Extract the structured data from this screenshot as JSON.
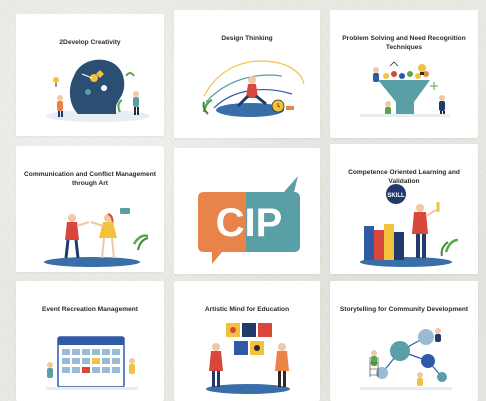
{
  "cards": [
    {
      "title": "2Develop Creativity",
      "icon": "creativity-illustration"
    },
    {
      "title": "Design Thinking",
      "icon": "design-thinking-illustration"
    },
    {
      "title": "Problem Solving and Need Recognition Techniques",
      "icon": "problem-solving-illustration"
    },
    {
      "title": "Communication and Conflict Management through Art",
      "icon": "communication-illustration"
    },
    {
      "title": "",
      "icon": "cip-logo"
    },
    {
      "title": "Competence Oriented Learning and Validation",
      "icon": "competence-illustration"
    },
    {
      "title": "Event Recreation Management",
      "icon": "event-calendar-illustration"
    },
    {
      "title": "Artistic Mind for Education",
      "icon": "artistic-mind-illustration"
    },
    {
      "title": "Storytelling for Community Development",
      "icon": "storytelling-illustration"
    }
  ],
  "logo": {
    "text": "CIP"
  },
  "competence_badge": {
    "text": "SKILL"
  },
  "colors": {
    "orange": "#e8844a",
    "teal": "#5a9ea6",
    "blue": "#2f5aa8",
    "dark_blue": "#1f3a6b",
    "yellow": "#f3c23d",
    "red": "#d9463b",
    "green": "#5aa64a"
  }
}
